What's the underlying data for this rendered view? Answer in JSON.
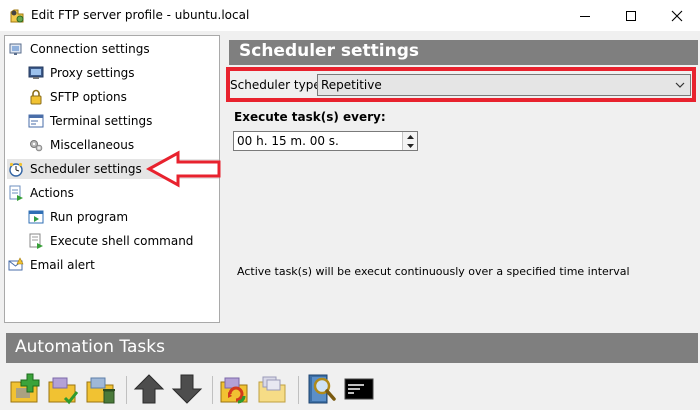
{
  "window": {
    "title": "Edit FTP server profile - ubuntu.local",
    "controls": [
      "minimize",
      "maximize",
      "close"
    ]
  },
  "sidebar": {
    "items": [
      {
        "label": "Connection settings",
        "icon": "plug-icon",
        "level": 0
      },
      {
        "label": "Proxy settings",
        "icon": "monitor-icon",
        "level": 1
      },
      {
        "label": "SFTP options",
        "icon": "lock-icon",
        "level": 1
      },
      {
        "label": "Terminal settings",
        "icon": "terminal-window-icon",
        "level": 1
      },
      {
        "label": "Miscellaneous",
        "icon": "gears-icon",
        "level": 1
      },
      {
        "label": "Scheduler settings",
        "icon": "clock-icon",
        "level": 0,
        "selected": true
      },
      {
        "label": "Actions",
        "icon": "actions-icon",
        "level": 0
      },
      {
        "label": "Run program",
        "icon": "run-window-icon",
        "level": 1
      },
      {
        "label": "Execute shell command",
        "icon": "script-icon",
        "level": 1
      },
      {
        "label": "Email alert",
        "icon": "email-alert-icon",
        "level": 0
      }
    ]
  },
  "main": {
    "header": "Scheduler settings",
    "scheduler_type_label": "Scheduler type:",
    "scheduler_type_value": "Repetitive",
    "execute_label": "Execute task(s) every:",
    "interval_value": "00 h. 15 m. 00 s.",
    "description": "Active task(s) will be execut continuously over a specified time interval"
  },
  "automation": {
    "header": "Automation Tasks",
    "toolbar": [
      "add-task-icon",
      "edit-task-icon",
      "delete-task-icon",
      "move-up-icon",
      "move-down-icon",
      "refresh-task-icon",
      "copy-task-icon",
      "search-log-icon",
      "console-icon"
    ]
  },
  "colors": {
    "header_gray": "#7f7f7f",
    "highlight_red": "#e8222e",
    "selected_bg": "#e5e5e5"
  }
}
